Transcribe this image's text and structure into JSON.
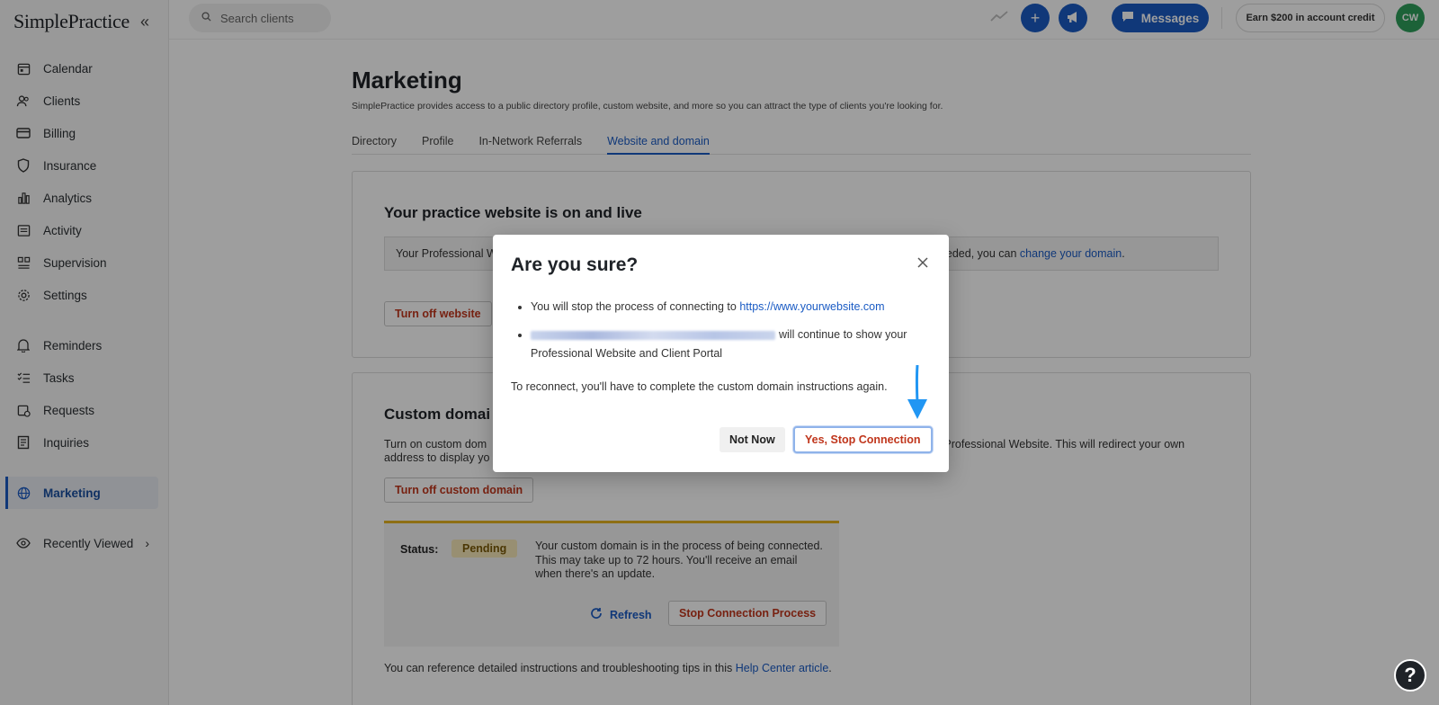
{
  "sidebar": {
    "logo": "SimplePractice",
    "collapse_icon": "«",
    "items": [
      {
        "label": "Calendar",
        "icon": "calendar-icon"
      },
      {
        "label": "Clients",
        "icon": "users-icon"
      },
      {
        "label": "Billing",
        "icon": "card-icon"
      },
      {
        "label": "Insurance",
        "icon": "shield-icon"
      },
      {
        "label": "Analytics",
        "icon": "bar-chart-icon"
      },
      {
        "label": "Activity",
        "icon": "list-icon"
      },
      {
        "label": "Supervision",
        "icon": "grid-icon"
      },
      {
        "label": "Settings",
        "icon": "gear-icon"
      }
    ],
    "items2": [
      {
        "label": "Reminders",
        "icon": "bell-icon"
      },
      {
        "label": "Tasks",
        "icon": "checklist-icon"
      },
      {
        "label": "Requests",
        "icon": "calendar-request-icon"
      },
      {
        "label": "Inquiries",
        "icon": "document-icon"
      }
    ],
    "active": {
      "label": "Marketing",
      "icon": "globe-icon"
    },
    "recent": {
      "label": "Recently Viewed",
      "icon": "eye-icon"
    }
  },
  "topbar": {
    "search_placeholder": "Search clients",
    "messages_label": "Messages",
    "credit_label": "Earn $200 in account credit",
    "avatar_initials": "CW"
  },
  "main": {
    "title": "Marketing",
    "subtitle": "SimplePractice provides access to a public directory profile, custom website, and more so you can attract the type of clients you're looking for.",
    "tabs": [
      {
        "label": "Directory"
      },
      {
        "label": "Profile"
      },
      {
        "label": "In-Network Referrals"
      },
      {
        "label": "Website and domain"
      }
    ],
    "card1": {
      "heading": "Your practice website is on and live",
      "info_left": "Your Professional W",
      "info_right_prefix": "needed, you can ",
      "info_right_link": "change your domain",
      "info_right_suffix": ".",
      "turn_off_label": "Turn off website"
    },
    "card2": {
      "heading": "Custom domai",
      "desc_left": "Turn on custom dom",
      "desc_right": "e Professional Website. This will redirect your own",
      "desc_line2": "address to display yo",
      "turn_off_label": "Turn off custom domain",
      "status_label": "Status:",
      "status_value": "Pending",
      "status_text": "Your custom domain is in the process of being connected. This may take up to 72 hours. You'll receive an email when there's an update.",
      "refresh_label": "Refresh",
      "stop_label": "Stop Connection Process",
      "help_prefix": "You can reference detailed instructions and troubleshooting tips in this ",
      "help_link": "Help Center article",
      "help_suffix": "."
    }
  },
  "modal": {
    "title": "Are you sure?",
    "bullet1_prefix": "You will stop the process of connecting to ",
    "bullet1_link": "https://www.yourwebsite.com",
    "bullet2_suffix": "will continue to show your Professional Website and Client Portal",
    "note": "To reconnect, you'll have to complete the custom domain instructions again.",
    "not_now_label": "Not Now",
    "confirm_label": "Yes, Stop Connection"
  },
  "colors": {
    "brand_blue": "#1a5bc4",
    "danger_red": "#c0361c",
    "pending_bg": "#f6e7b8",
    "pending_border": "#e6b422",
    "arrow_blue": "#2196f3"
  }
}
